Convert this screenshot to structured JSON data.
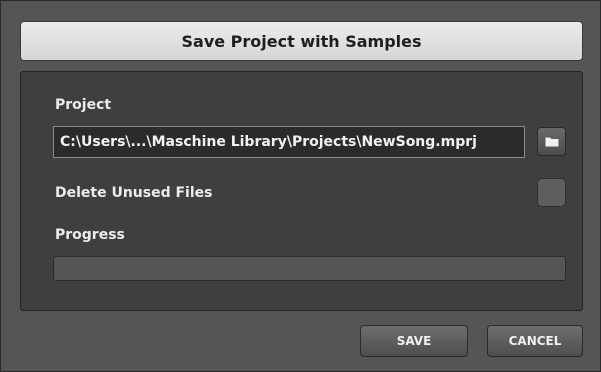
{
  "dialog": {
    "title": "Save Project with Samples"
  },
  "project": {
    "label": "Project",
    "path_value": "C:\\Users\\...\\Maschine Library\\Projects\\NewSong.mprj",
    "browse_icon": "folder-icon"
  },
  "delete_unused": {
    "label": "Delete Unused Files",
    "checked": false
  },
  "progress": {
    "label": "Progress",
    "value": 0
  },
  "buttons": {
    "save_label": "SAVE",
    "cancel_label": "CANCEL"
  }
}
